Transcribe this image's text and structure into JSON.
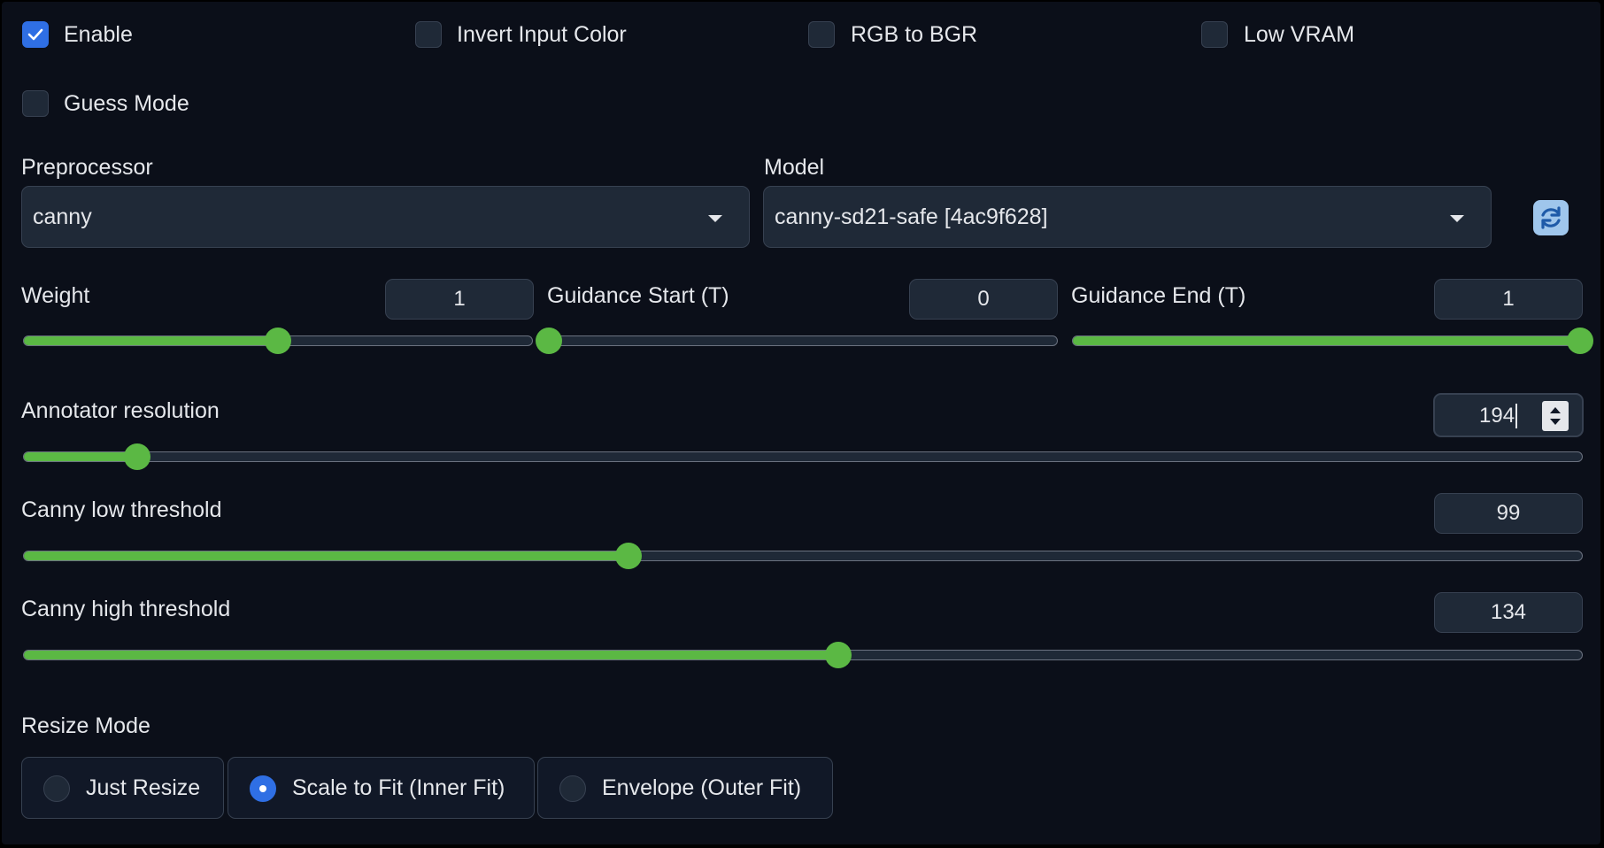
{
  "checkboxes": {
    "enable": {
      "label": "Enable",
      "checked": true
    },
    "invert": {
      "label": "Invert Input Color",
      "checked": false
    },
    "rgb_bgr": {
      "label": "RGB to BGR",
      "checked": false
    },
    "low_vram": {
      "label": "Low VRAM",
      "checked": false
    },
    "guess_mode": {
      "label": "Guess Mode",
      "checked": false
    }
  },
  "preprocessor": {
    "label": "Preprocessor",
    "value": "canny"
  },
  "model": {
    "label": "Model",
    "value": "canny-sd21-safe [4ac9f628]"
  },
  "refresh_icon": "refresh-icon",
  "sliders": {
    "weight": {
      "label": "Weight",
      "value": "1",
      "fraction": 0.5
    },
    "guidance_start": {
      "label": "Guidance Start (T)",
      "value": "0",
      "fraction": 0.0
    },
    "guidance_end": {
      "label": "Guidance End (T)",
      "value": "1",
      "fraction": 1.0
    },
    "annotator_resolution": {
      "label": "Annotator resolution",
      "value": "194",
      "fraction": 0.073
    },
    "canny_low": {
      "label": "Canny low threshold",
      "value": "99",
      "fraction": 0.388
    },
    "canny_high": {
      "label": "Canny high threshold",
      "value": "134",
      "fraction": 0.523
    }
  },
  "resize_mode": {
    "label": "Resize Mode",
    "options": [
      {
        "label": "Just Resize",
        "selected": false
      },
      {
        "label": "Scale to Fit (Inner Fit)",
        "selected": true
      },
      {
        "label": "Envelope (Outer Fit)",
        "selected": false
      }
    ]
  },
  "colors": {
    "accent": "#5bb844",
    "checked": "#2f6fe4",
    "background": "#0b0f19"
  }
}
